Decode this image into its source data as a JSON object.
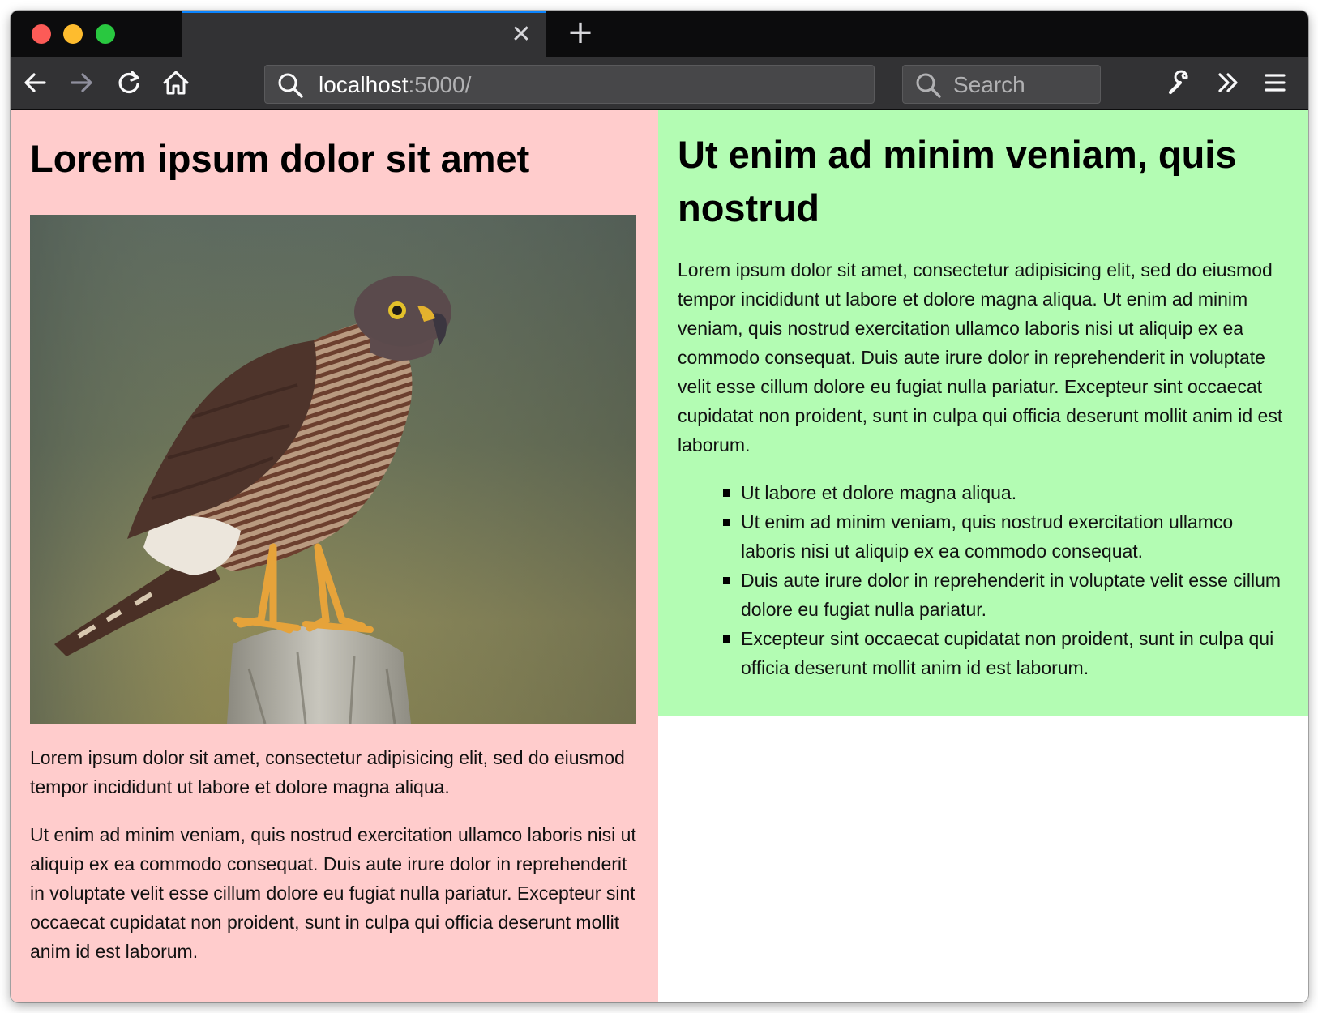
{
  "browser": {
    "tab_title": "",
    "url_host": "localhost",
    "url_rest": ":5000/",
    "search_placeholder": "Search",
    "icons": [
      "back-arrow-icon",
      "forward-arrow-icon",
      "reload-icon",
      "home-icon",
      "search-icon",
      "wrench-icon",
      "overflow-chevrons-icon",
      "hamburger-menu-icon",
      "close-icon",
      "plus-icon"
    ]
  },
  "left": {
    "heading": "Lorem ipsum dolor sit amet",
    "image_alt": "hawk perched on a post",
    "para1": "Lorem ipsum dolor sit amet, consectetur adipisicing elit, sed do eiusmod tempor incididunt ut labore et dolore magna aliqua.",
    "para2": "Ut enim ad minim veniam, quis nostrud exercitation ullamco laboris nisi ut aliquip ex ea commodo consequat. Duis aute irure dolor in reprehenderit in voluptate velit esse cillum dolore eu fugiat nulla pariatur. Excepteur sint occaecat cupidatat non proident, sunt in culpa qui officia deserunt mollit anim id est laborum."
  },
  "right": {
    "heading": "Ut enim ad minim veniam, quis nostrud",
    "para1": "Lorem ipsum dolor sit amet, consectetur adipisicing elit, sed do eiusmod tempor incididunt ut labore et dolore magna aliqua. Ut enim ad minim veniam, quis nostrud exercitation ullamco laboris nisi ut aliquip ex ea commodo consequat. Duis aute irure dolor in reprehenderit in voluptate velit esse cillum dolore eu fugiat nulla pariatur. Excepteur sint occaecat cupidatat non proident, sunt in culpa qui officia deserunt mollit anim id est laborum.",
    "bullets": [
      "Ut labore et dolore magna aliqua.",
      "Ut enim ad minim veniam, quis nostrud exercitation ullamco laboris nisi ut aliquip ex ea commodo consequat.",
      "Duis aute irure dolor in reprehenderit in voluptate velit esse cillum dolore eu fugiat nulla pariatur.",
      "Excepteur sint occaecat cupidatat non proident, sunt in culpa qui officia deserunt mollit anim id est laborum."
    ]
  },
  "colors": {
    "left_bg": "#ffcccc",
    "right_bg": "#b3fcb3",
    "toolbar_bg": "#323234",
    "tabstrip_bg": "#0c0c0d",
    "tab_accent": "#0a84ff"
  }
}
